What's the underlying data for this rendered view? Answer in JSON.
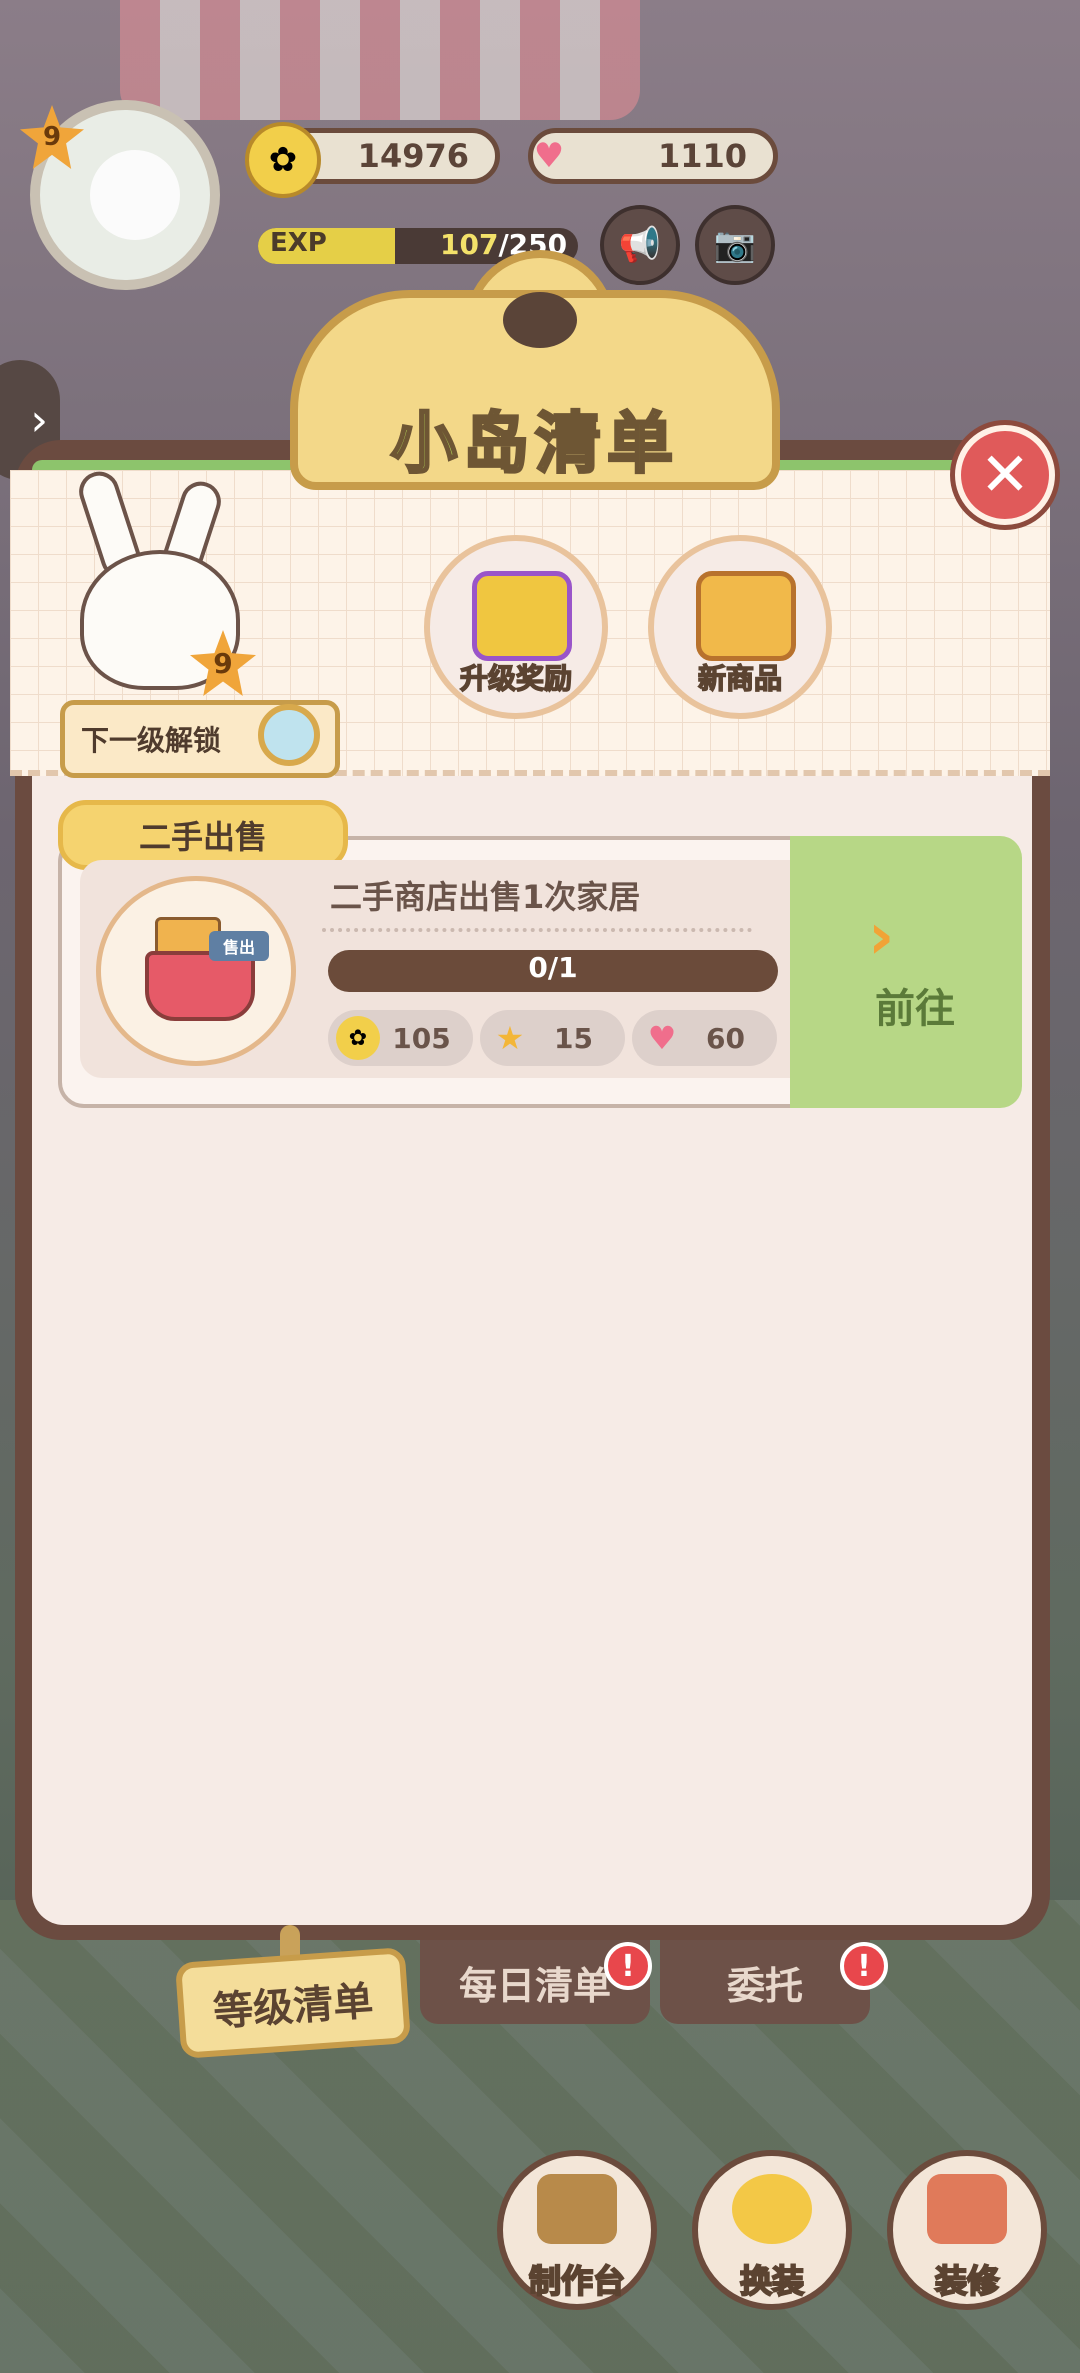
{
  "hud": {
    "level": "9",
    "coins": "14976",
    "hearts": "1110",
    "exp_label": "EXP",
    "exp_current": "107",
    "exp_max": "/250",
    "exp_progress": 0.428
  },
  "panel": {
    "title": "小岛清单",
    "unlock_level": "9",
    "unlock_label": "下一级解锁",
    "buttons": [
      {
        "label": "升级奖励",
        "icon": "gift-box-icon"
      },
      {
        "label": "新商品",
        "icon": "bag-icon"
      }
    ]
  },
  "task": {
    "category": "二手出售",
    "title": "二手商店出售1次家居",
    "sell_tag": "售出",
    "progress_text": "0/1",
    "progress_value": 0,
    "rewards": [
      {
        "icon": "coin-icon",
        "value": "105"
      },
      {
        "icon": "star-icon",
        "value": "15"
      },
      {
        "icon": "heart-icon",
        "value": "60"
      }
    ],
    "go_label": "前往"
  },
  "tabs": [
    {
      "label": "等级清单",
      "active": true
    },
    {
      "label": "每日清单",
      "alert": true
    },
    {
      "label": "委托",
      "alert": true
    }
  ],
  "bottom_buttons": [
    {
      "label": "制作台"
    },
    {
      "label": "换装"
    },
    {
      "label": "装修"
    }
  ],
  "colors": {
    "accent_green": "#b7d786",
    "progress_yellow": "#e5cf47",
    "panel_brown": "#6b4b40",
    "close_red": "#e05a5a"
  }
}
